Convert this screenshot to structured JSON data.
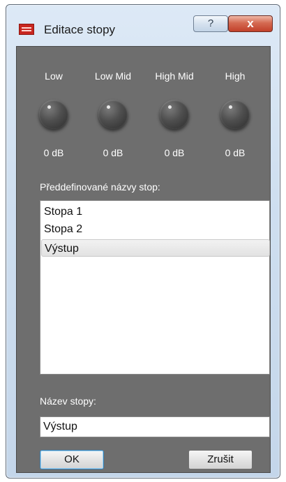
{
  "window": {
    "title": "Editace stopy",
    "help_glyph": "?",
    "close_glyph": "x",
    "accent_close": "#c2402a"
  },
  "eq": {
    "bands": [
      {
        "label": "Low",
        "value": "0 dB"
      },
      {
        "label": "Low Mid",
        "value": "0 dB"
      },
      {
        "label": "High Mid",
        "value": "0 dB"
      },
      {
        "label": "High",
        "value": "0 dB"
      }
    ]
  },
  "presets": {
    "label": "Předdefinované názvy stop:",
    "items": [
      "Stopa 1",
      "Stopa 2",
      "Výstup"
    ],
    "selected": "Výstup"
  },
  "track_name": {
    "label": "Název stopy:",
    "value": "Výstup"
  },
  "buttons": {
    "ok": "OK",
    "cancel": "Zrušit"
  },
  "icons": {
    "app": "app-logo-icon",
    "knob": "rotary-knob-icon"
  }
}
